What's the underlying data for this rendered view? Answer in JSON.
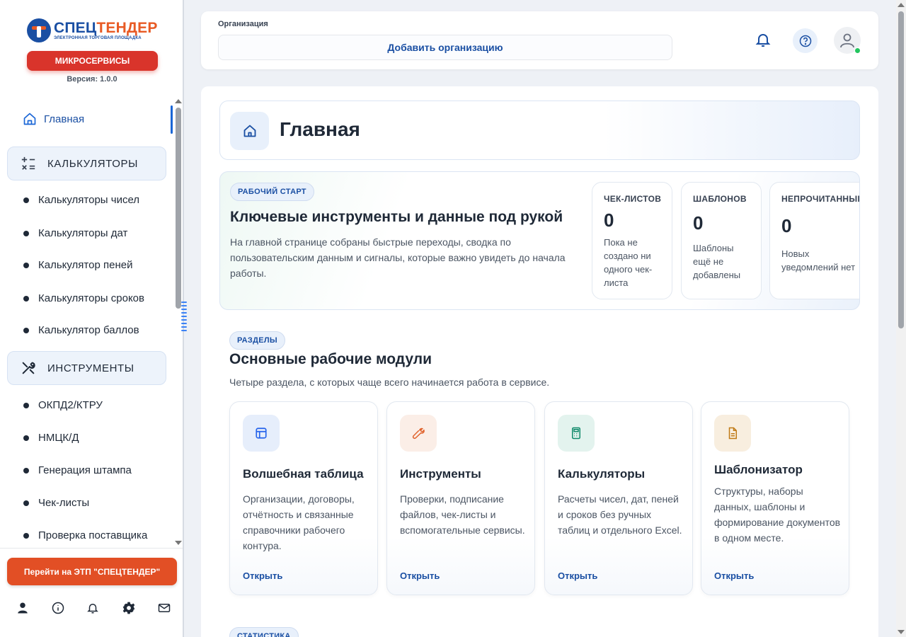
{
  "brand": {
    "name_part1": "СПЕЦ",
    "name_part2": "ТЕНДЕР",
    "subtitle": "ЭЛЕКТРОННАЯ ТОРГОВАЯ ПЛОЩАДКА",
    "micro_button": "МИКРОСЕРВИСЫ",
    "version": "Версия: 1.0.0"
  },
  "sidebar": {
    "home": "Главная",
    "groups": [
      {
        "label": "КАЛЬКУЛЯТОРЫ",
        "items": [
          "Калькуляторы чисел",
          "Калькуляторы дат",
          "Калькулятор пеней",
          "Калькуляторы сроков",
          "Калькулятор баллов"
        ]
      },
      {
        "label": "ИНСТРУМЕНТЫ",
        "items": [
          "ОКПД2/КТРУ",
          "НМЦК/Д",
          "Генерация штампа",
          "Чек-листы",
          "Проверка поставщика"
        ]
      }
    ],
    "etp_button": "Перейти на ЭТП \"СПЕЦТЕНДЕР\"",
    "footer_icons": [
      "user-icon",
      "info-icon",
      "bell-icon",
      "gear-icon",
      "mail-icon"
    ]
  },
  "topbar": {
    "org_label": "Организация",
    "org_button": "Добавить организацию",
    "icons": [
      "bell-icon",
      "help-icon",
      "avatar-icon"
    ]
  },
  "page": {
    "title": "Главная",
    "start": {
      "pill": "РАБОЧИЙ СТАРТ",
      "title": "Ключевые инструменты и данные под рукой",
      "desc": "На главной странице собраны быстрые переходы, сводка по пользовательским данным и сигналы, которые важно увидеть до начала работы.",
      "stats": [
        {
          "label": "ЧЕК-ЛИСТОВ",
          "value": "0",
          "desc": "Пока не создано ни одного чек-листа"
        },
        {
          "label": "ШАБЛОНОВ",
          "value": "0",
          "desc": "Шаблоны ещё не добавлены"
        },
        {
          "label": "НЕПРОЧИТАННЫЕ",
          "value": "0",
          "desc": "Новых уведомлений нет"
        }
      ]
    },
    "sections": {
      "pill": "РАЗДЕЛЫ",
      "title": "Основные рабочие модули",
      "desc": "Четыре раздела, с которых чаще всего начинается работа в сервисе.",
      "modules": [
        {
          "title": "Волшебная таблица",
          "desc": "Организации, договоры, отчётность и связанные справочники рабочего контура.",
          "link": "Открыть",
          "icon": "table-icon",
          "color": "#2563eb",
          "bg": "#e6eefb"
        },
        {
          "title": "Инструменты",
          "desc": "Проверки, подписание файлов, чек-листы и вспомогательные сервисы.",
          "link": "Открыть",
          "icon": "wrench-icon",
          "color": "#e0622c",
          "bg": "#fbeee7"
        },
        {
          "title": "Калькуляторы",
          "desc": "Расчеты чисел, дат, пеней и сроков без ручных таблиц и отдельного Excel.",
          "link": "Открыть",
          "icon": "calculator-icon",
          "color": "#0f8a6a",
          "bg": "#e3f3ee"
        },
        {
          "title": "Шаблонизатор",
          "desc": "Структуры, наборы данных, шаблоны и формирование документов в одном месте.",
          "link": "Открыть",
          "icon": "document-icon",
          "color": "#c07a16",
          "bg": "#f8eedf"
        }
      ]
    },
    "stats_pill": "СТАТИСТИКА"
  }
}
